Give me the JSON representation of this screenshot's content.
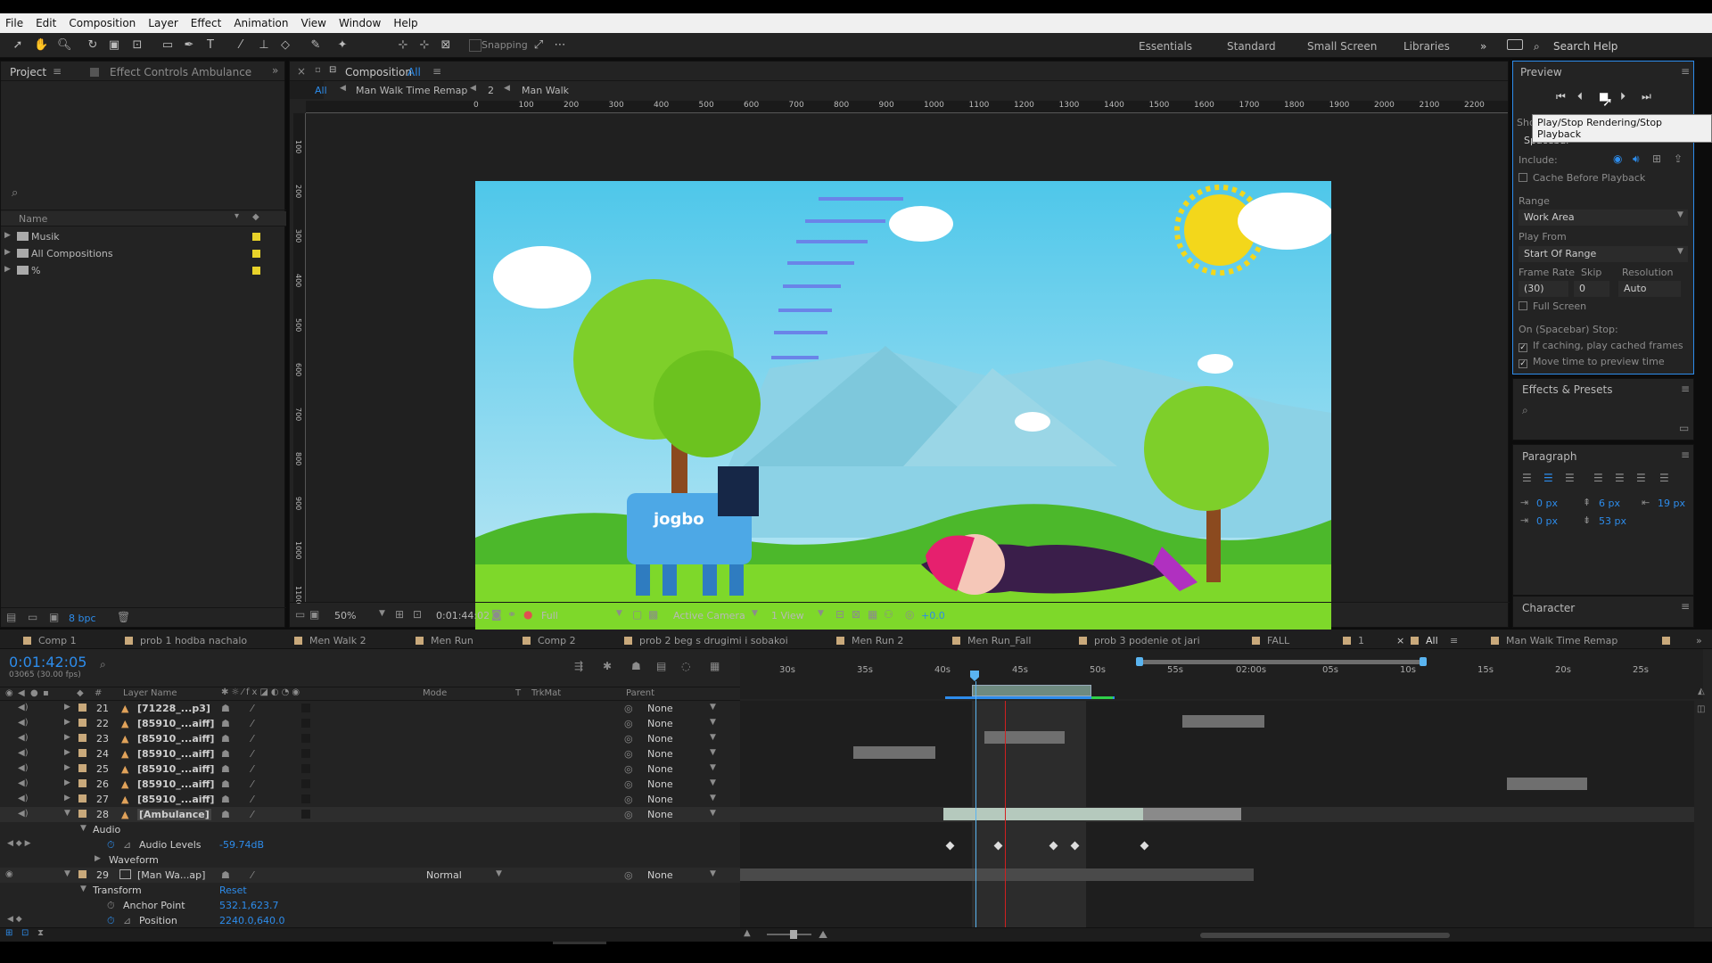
{
  "menu": [
    "File",
    "Edit",
    "Composition",
    "Layer",
    "Effect",
    "Animation",
    "View",
    "Window",
    "Help"
  ],
  "toolbar": {
    "snapping": "Snapping",
    "workspaces": [
      "Essentials",
      "Standard",
      "Small Screen",
      "Libraries"
    ],
    "search_help": "Search Help"
  },
  "project": {
    "tab_project": "Project",
    "tab_effect_controls": "Effect Controls Ambulance",
    "col_name": "Name",
    "items": [
      "Musik",
      "All Compositions",
      "%"
    ],
    "bpc": "8 bpc"
  },
  "composition": {
    "tab": "Composition",
    "tab_name": "All",
    "breadcrumb": [
      "All",
      "Man Walk Time Remap",
      "2",
      "Man Walk"
    ],
    "zoom": "50%",
    "timecode": "0:01:44:02",
    "resolution": "Full",
    "camera": "Active Camera",
    "view": "1 View",
    "exposure": "+0.0",
    "ruler": [
      "0",
      "100",
      "200",
      "300",
      "400",
      "500",
      "600",
      "700",
      "800",
      "900",
      "1000",
      "1100",
      "1200",
      "1300",
      "1400",
      "1500",
      "1600",
      "1700",
      "1800",
      "1900",
      "2000",
      "2100",
      "2200"
    ],
    "ruler_v": [
      "100",
      "200",
      "300",
      "400",
      "500",
      "600",
      "700",
      "800",
      "900",
      "1000",
      "1100"
    ],
    "jogbo_text": "jogbo"
  },
  "preview": {
    "title": "Preview",
    "tooltip": "Play/Stop Rendering/Stop Playback",
    "shortcut_label": "Sho",
    "shortcut": "Spacebar",
    "include": "Include:",
    "cache_before": "Cache Before Playback",
    "range_label": "Range",
    "range": "Work Area",
    "play_from_label": "Play From",
    "play_from": "Start Of Range",
    "frame_rate_label": "Frame Rate",
    "skip_label": "Skip",
    "resolution_label": "Resolution",
    "frame_rate": "(30)",
    "skip": "0",
    "resolution": "Auto",
    "full_screen": "Full Screen",
    "on_stop": "On (Spacebar) Stop:",
    "opt1": "If caching, play cached frames",
    "opt2": "Move time to preview time"
  },
  "effects": {
    "title": "Effects & Presets"
  },
  "paragraph": {
    "title": "Paragraph",
    "v1": "0 px",
    "v2": "6 px",
    "v3": "19 px",
    "v4": "0 px",
    "v5": "53 px"
  },
  "character": {
    "title": "Character"
  },
  "timeline": {
    "tabs": [
      "Comp 1",
      "prob 1 hodba nachalo",
      "Men Walk 2",
      "Men Run",
      "Comp 2",
      "prob 2 beg s drugimi i sobakoi",
      "Men Run 2",
      "Men Run_Fall",
      "prob 3 podenie ot jari",
      "FALL",
      "1",
      "All",
      "Man Walk Time Remap"
    ],
    "timecode": "0:01:42:05",
    "fps": "03065 (30.00 fps)",
    "cols": {
      "layer_name": "Layer Name",
      "mode": "Mode",
      "t": "T",
      "trkmat": "TrkMat",
      "parent": "Parent"
    },
    "layers": [
      {
        "num": "21",
        "name": "[71228_...p3]",
        "parent": "None"
      },
      {
        "num": "22",
        "name": "[85910_...aiff]",
        "parent": "None"
      },
      {
        "num": "23",
        "name": "[85910_...aiff]",
        "parent": "None"
      },
      {
        "num": "24",
        "name": "[85910_...aiff]",
        "parent": "None"
      },
      {
        "num": "25",
        "name": "[85910_...aiff]",
        "parent": "None"
      },
      {
        "num": "26",
        "name": "[85910_...aiff]",
        "parent": "None"
      },
      {
        "num": "27",
        "name": "[85910_...aiff]",
        "parent": "None"
      },
      {
        "num": "28",
        "name": "[Ambulance]",
        "parent": "None"
      }
    ],
    "audio": "Audio",
    "audio_levels": "Audio Levels",
    "audio_levels_val": "-59.74dB",
    "waveform": "Waveform",
    "layer29": {
      "num": "29",
      "name": "[Man Wa...ap]",
      "mode": "Normal",
      "parent": "None"
    },
    "transform": "Transform",
    "reset": "Reset",
    "anchor": "Anchor Point",
    "anchor_val": "532.1,623.7",
    "position": "Position",
    "position_val": "2240.0,640.0",
    "ticks": [
      "30s",
      "35s",
      "40s",
      "45s",
      "50s",
      "55s",
      "02:00s",
      "05s",
      "10s",
      "15s",
      "20s",
      "25s"
    ]
  },
  "colors": {
    "accent": "#2d8ceb",
    "label_yellow": "#e8d22a",
    "label_tan": "#c9a97b",
    "playhead": "#5ab4f0",
    "sky": "#4ec7ea",
    "grass": "#7ed82a"
  }
}
